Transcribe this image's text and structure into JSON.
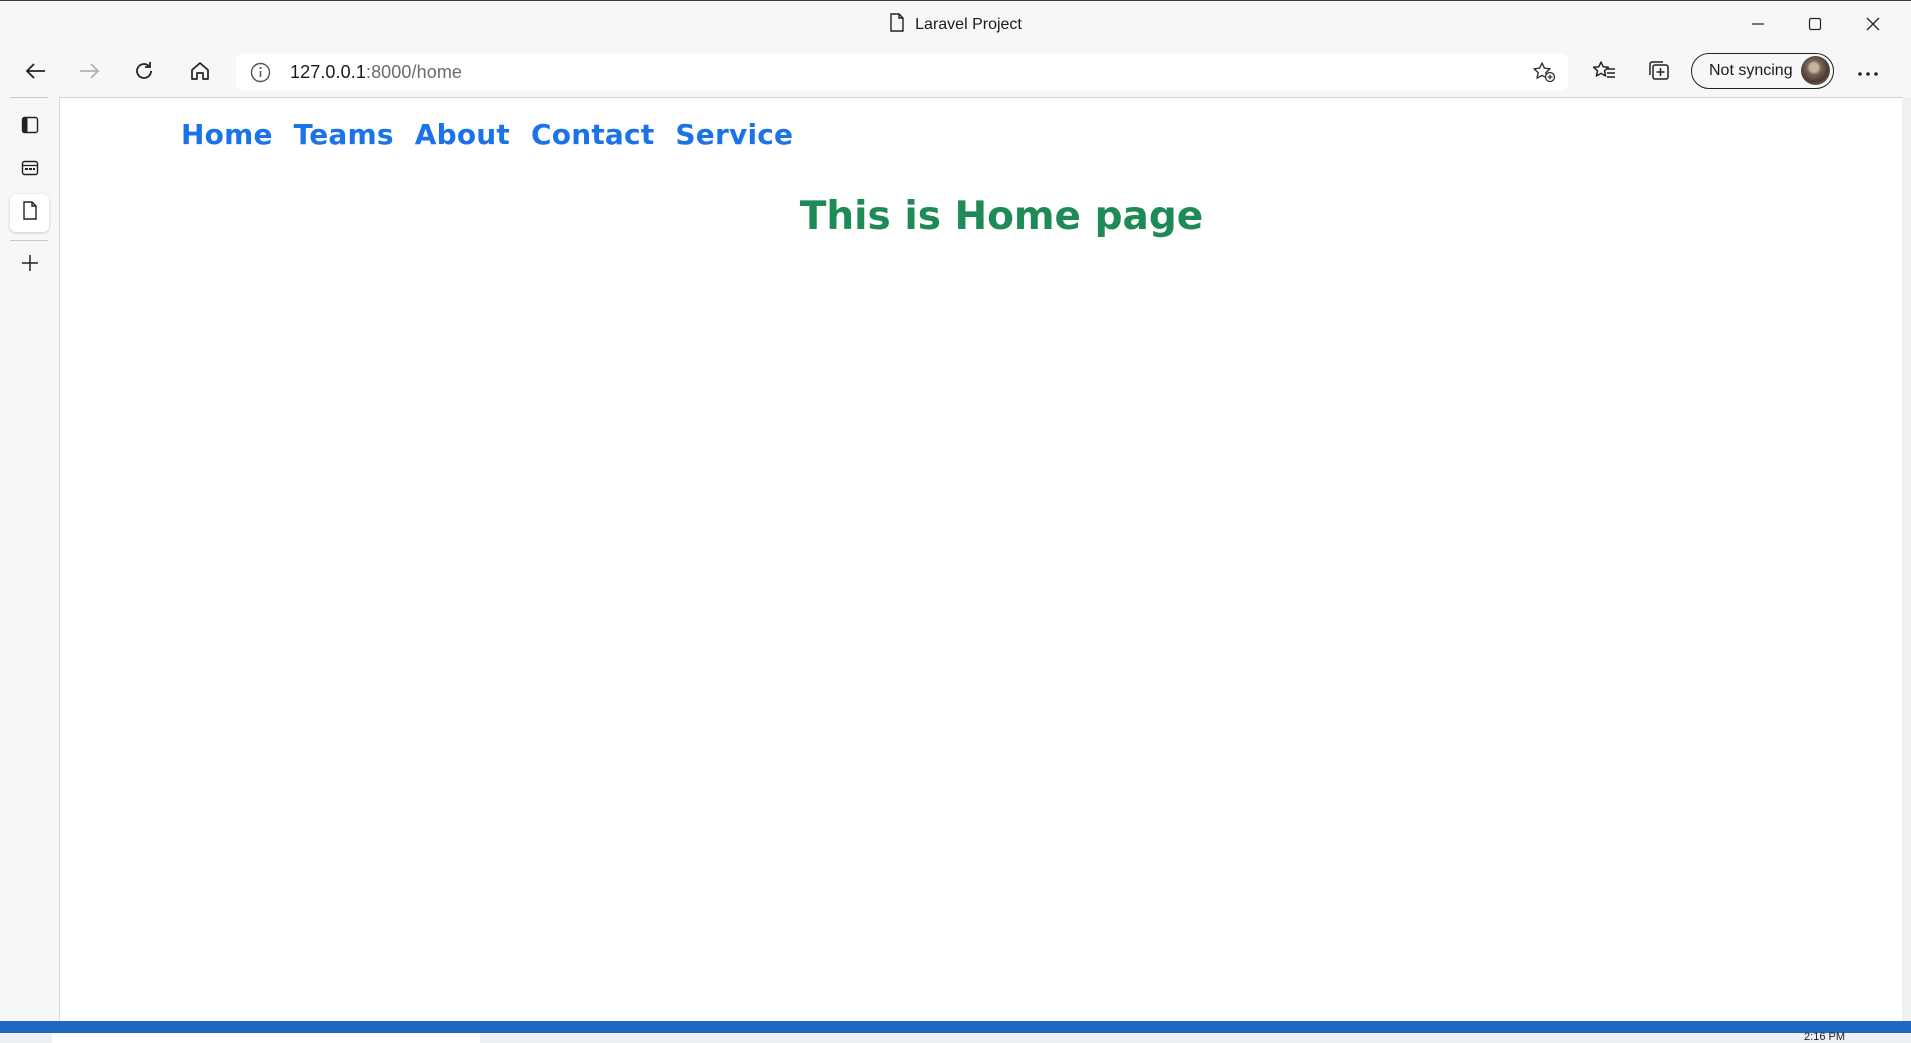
{
  "window": {
    "title": "Laravel Project",
    "controls": [
      "minimize-icon",
      "maximize-icon",
      "close-icon"
    ]
  },
  "toolbar": {
    "address": {
      "host": "127.0.0.1",
      "path": ":8000/home"
    },
    "sync_label": "Not syncing",
    "icons": [
      "back-icon",
      "forward-icon",
      "refresh-icon",
      "home-icon",
      "info-icon",
      "add-favorite-icon",
      "favorites-icon",
      "collections-icon",
      "more-icon"
    ]
  },
  "sidebar": {
    "icons": [
      "tab-actions-icon",
      "workspaces-icon",
      "page-tab-icon",
      "new-tab-plus-icon"
    ]
  },
  "page": {
    "nav": [
      {
        "label": "Home"
      },
      {
        "label": "Teams"
      },
      {
        "label": "About"
      },
      {
        "label": "Contact"
      },
      {
        "label": "Service"
      }
    ],
    "heading": "This is Home page"
  },
  "taskbar": {
    "clock": "2:16 PM"
  },
  "colors": {
    "link": "#1a73e8",
    "heading": "#1e8a55",
    "status_bar": "#1f67c0"
  }
}
